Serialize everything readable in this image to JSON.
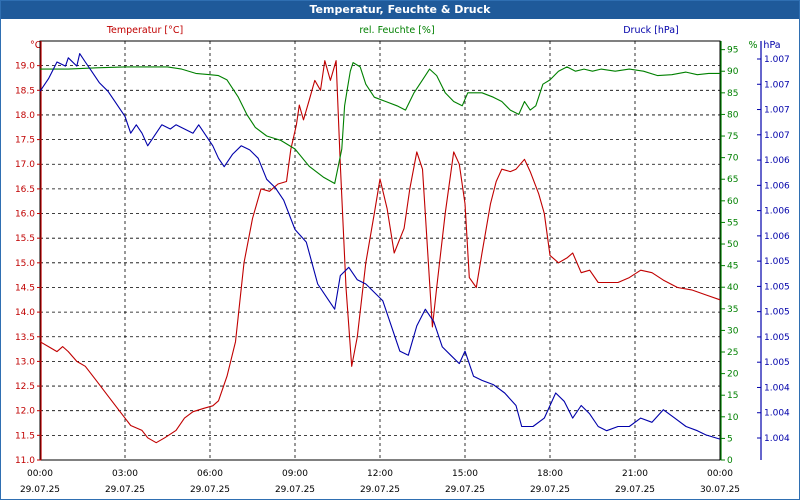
{
  "window": {
    "title": "Temperatur, Feuchte & Druck"
  },
  "colors": {
    "temperature": "#c00000",
    "humidity": "#008000",
    "pressure": "#0000aa",
    "grid": "#000000"
  },
  "chart_data": {
    "type": "line",
    "title": "Temperatur, Feuchte & Druck",
    "x_range": [
      "29.07.25 00:00",
      "30.07.25 00:00"
    ],
    "x_ticks": [
      {
        "time": "00:00",
        "date": "29.07.25"
      },
      {
        "time": "03:00",
        "date": "29.07.25"
      },
      {
        "time": "06:00",
        "date": "29.07.25"
      },
      {
        "time": "09:00",
        "date": "29.07.25"
      },
      {
        "time": "12:00",
        "date": "29.07.25"
      },
      {
        "time": "15:00",
        "date": "29.07.25"
      },
      {
        "time": "18:00",
        "date": "29.07.25"
      },
      {
        "time": "21:00",
        "date": "29.07.25"
      },
      {
        "time": "00:00",
        "date": "30.07.25"
      }
    ],
    "grid": true,
    "axes": {
      "temperature": {
        "label": "Temperatur [°C]",
        "unit": "°C",
        "range": [
          11.0,
          19.5
        ],
        "ticks": [
          "11.0",
          "11.5",
          "12.0",
          "12.5",
          "13.0",
          "13.5",
          "14.0",
          "14.5",
          "15.0",
          "15.5",
          "16.0",
          "16.5",
          "17.0",
          "17.5",
          "18.0",
          "18.5",
          "19.0"
        ]
      },
      "humidity": {
        "label": "rel. Feuchte [%]",
        "unit": "%",
        "range": [
          0,
          97
        ],
        "ticks": [
          "0",
          "5",
          "10",
          "15",
          "20",
          "25",
          "30",
          "35",
          "40",
          "45",
          "50",
          "55",
          "60",
          "65",
          "70",
          "75",
          "80",
          "85",
          "90",
          "95"
        ]
      },
      "pressure": {
        "label": "Druck [hPa]",
        "unit": "hPa",
        "ticks": [
          "1.007",
          "1.007",
          "1.007",
          "1.007",
          "1.006",
          "1.006",
          "1.006",
          "1.006",
          "1.005",
          "1.005",
          "1.005",
          "1.005",
          "1.005",
          "1.004",
          "1.004",
          "1.004"
        ]
      }
    },
    "series": [
      {
        "name": "Temperatur [°C]",
        "axis": "temperature",
        "points": [
          [
            0,
            13.4
          ],
          [
            0.3,
            13.3
          ],
          [
            0.6,
            13.2
          ],
          [
            0.8,
            13.3
          ],
          [
            1.0,
            13.2
          ],
          [
            1.3,
            13.0
          ],
          [
            1.6,
            12.9
          ],
          [
            2.0,
            12.6
          ],
          [
            2.4,
            12.3
          ],
          [
            2.8,
            12.0
          ],
          [
            3.2,
            11.7
          ],
          [
            3.6,
            11.6
          ],
          [
            3.8,
            11.45
          ],
          [
            4.1,
            11.35
          ],
          [
            4.4,
            11.45
          ],
          [
            4.8,
            11.6
          ],
          [
            5.1,
            11.85
          ],
          [
            5.4,
            11.98
          ],
          [
            5.8,
            12.05
          ],
          [
            6.1,
            12.1
          ],
          [
            6.3,
            12.2
          ],
          [
            6.6,
            12.7
          ],
          [
            6.9,
            13.4
          ],
          [
            7.2,
            15.0
          ],
          [
            7.5,
            15.9
          ],
          [
            7.8,
            16.5
          ],
          [
            8.1,
            16.45
          ],
          [
            8.4,
            16.6
          ],
          [
            8.7,
            16.65
          ],
          [
            8.85,
            17.3
          ],
          [
            9.05,
            17.8
          ],
          [
            9.15,
            18.2
          ],
          [
            9.3,
            17.9
          ],
          [
            9.5,
            18.3
          ],
          [
            9.7,
            18.7
          ],
          [
            9.9,
            18.5
          ],
          [
            10.05,
            19.1
          ],
          [
            10.25,
            18.7
          ],
          [
            10.45,
            19.1
          ],
          [
            10.6,
            17.0
          ],
          [
            10.8,
            14.5
          ],
          [
            11.0,
            12.9
          ],
          [
            11.2,
            13.5
          ],
          [
            11.5,
            15.0
          ],
          [
            11.8,
            16.0
          ],
          [
            12.0,
            16.7
          ],
          [
            12.25,
            16.1
          ],
          [
            12.5,
            15.2
          ],
          [
            12.85,
            15.7
          ],
          [
            13.05,
            16.5
          ],
          [
            13.3,
            17.25
          ],
          [
            13.5,
            16.9
          ],
          [
            13.6,
            16.0
          ],
          [
            13.75,
            14.6
          ],
          [
            13.85,
            13.7
          ],
          [
            14.0,
            14.5
          ],
          [
            14.3,
            16.0
          ],
          [
            14.6,
            17.25
          ],
          [
            14.8,
            17.0
          ],
          [
            15.0,
            16.2
          ],
          [
            15.15,
            14.7
          ],
          [
            15.4,
            14.5
          ],
          [
            15.6,
            15.2
          ],
          [
            15.9,
            16.2
          ],
          [
            16.1,
            16.65
          ],
          [
            16.3,
            16.9
          ],
          [
            16.6,
            16.85
          ],
          [
            16.8,
            16.9
          ],
          [
            17.1,
            17.1
          ],
          [
            17.3,
            16.85
          ],
          [
            17.6,
            16.4
          ],
          [
            17.8,
            16.0
          ],
          [
            18.0,
            15.15
          ],
          [
            18.3,
            15.0
          ],
          [
            18.6,
            15.1
          ],
          [
            18.8,
            15.2
          ],
          [
            19.1,
            14.8
          ],
          [
            19.4,
            14.85
          ],
          [
            19.7,
            14.6
          ],
          [
            20.0,
            14.6
          ],
          [
            20.4,
            14.6
          ],
          [
            20.8,
            14.7
          ],
          [
            21.2,
            14.85
          ],
          [
            21.6,
            14.8
          ],
          [
            22.0,
            14.65
          ],
          [
            22.5,
            14.5
          ],
          [
            23.0,
            14.45
          ],
          [
            23.5,
            14.35
          ],
          [
            24.0,
            14.25
          ]
        ]
      },
      {
        "name": "rel. Feuchte [%]",
        "axis": "humidity",
        "points": [
          [
            0,
            90.5
          ],
          [
            1.0,
            90.5
          ],
          [
            2.0,
            90.8
          ],
          [
            3.0,
            91
          ],
          [
            4.0,
            91
          ],
          [
            4.5,
            91
          ],
          [
            5.0,
            90.5
          ],
          [
            5.5,
            89.5
          ],
          [
            6.0,
            89.2
          ],
          [
            6.3,
            89
          ],
          [
            6.6,
            88
          ],
          [
            7.0,
            84
          ],
          [
            7.3,
            80
          ],
          [
            7.6,
            77
          ],
          [
            8.0,
            75
          ],
          [
            8.5,
            74
          ],
          [
            9.0,
            72
          ],
          [
            9.5,
            68
          ],
          [
            10.0,
            65.5
          ],
          [
            10.4,
            64
          ],
          [
            10.65,
            72
          ],
          [
            10.75,
            82
          ],
          [
            10.85,
            86
          ],
          [
            10.95,
            90
          ],
          [
            11.05,
            92
          ],
          [
            11.3,
            91
          ],
          [
            11.5,
            87
          ],
          [
            11.8,
            84
          ],
          [
            12.2,
            83
          ],
          [
            12.6,
            82
          ],
          [
            12.9,
            81
          ],
          [
            13.2,
            85
          ],
          [
            13.5,
            88
          ],
          [
            13.75,
            90.5
          ],
          [
            14.0,
            89
          ],
          [
            14.3,
            85
          ],
          [
            14.6,
            83
          ],
          [
            14.9,
            82
          ],
          [
            15.1,
            85
          ],
          [
            15.3,
            85
          ],
          [
            15.6,
            85
          ],
          [
            16.0,
            84
          ],
          [
            16.3,
            83
          ],
          [
            16.6,
            81
          ],
          [
            16.9,
            80
          ],
          [
            17.1,
            83
          ],
          [
            17.3,
            81
          ],
          [
            17.5,
            82
          ],
          [
            17.75,
            87
          ],
          [
            18.0,
            88
          ],
          [
            18.3,
            90
          ],
          [
            18.6,
            91
          ],
          [
            18.9,
            90
          ],
          [
            19.2,
            90.5
          ],
          [
            19.5,
            90
          ],
          [
            19.8,
            90.5
          ],
          [
            20.3,
            90
          ],
          [
            20.8,
            90.5
          ],
          [
            21.3,
            90
          ],
          [
            21.8,
            89
          ],
          [
            22.3,
            89.2
          ],
          [
            22.8,
            89.8
          ],
          [
            23.2,
            89.2
          ],
          [
            23.6,
            89.5
          ],
          [
            24.0,
            89.5
          ]
        ]
      },
      {
        "name": "Druck [hPa]",
        "axis": "pressure",
        "points": [
          [
            0,
            88
          ],
          [
            0.3,
            91
          ],
          [
            0.6,
            95
          ],
          [
            0.9,
            94
          ],
          [
            1.0,
            96
          ],
          [
            1.3,
            94
          ],
          [
            1.4,
            97
          ],
          [
            1.6,
            95
          ],
          [
            1.8,
            93
          ],
          [
            2.1,
            90
          ],
          [
            2.4,
            88
          ],
          [
            2.6,
            86
          ],
          [
            3.0,
            82
          ],
          [
            3.2,
            78
          ],
          [
            3.4,
            80
          ],
          [
            3.6,
            78
          ],
          [
            3.8,
            75
          ],
          [
            4.0,
            77
          ],
          [
            4.3,
            80
          ],
          [
            4.6,
            79
          ],
          [
            4.8,
            80
          ],
          [
            5.1,
            79
          ],
          [
            5.4,
            78
          ],
          [
            5.6,
            80
          ],
          [
            5.9,
            77
          ],
          [
            6.1,
            75
          ],
          [
            6.3,
            72
          ],
          [
            6.5,
            70
          ],
          [
            6.8,
            73
          ],
          [
            7.1,
            75
          ],
          [
            7.4,
            74
          ],
          [
            7.7,
            72
          ],
          [
            8.0,
            67
          ],
          [
            8.3,
            65
          ],
          [
            8.6,
            62
          ],
          [
            9.0,
            55
          ],
          [
            9.4,
            52
          ],
          [
            9.8,
            42
          ],
          [
            10.2,
            38
          ],
          [
            10.4,
            36
          ],
          [
            10.6,
            44
          ],
          [
            10.9,
            46
          ],
          [
            11.2,
            43
          ],
          [
            11.5,
            42
          ],
          [
            11.8,
            40
          ],
          [
            12.1,
            38
          ],
          [
            12.4,
            32
          ],
          [
            12.7,
            26
          ],
          [
            13.0,
            25
          ],
          [
            13.3,
            32
          ],
          [
            13.6,
            36
          ],
          [
            13.9,
            33
          ],
          [
            14.2,
            27
          ],
          [
            14.5,
            25
          ],
          [
            14.8,
            23
          ],
          [
            15.0,
            26
          ],
          [
            15.3,
            20
          ],
          [
            15.6,
            19
          ],
          [
            16.0,
            18
          ],
          [
            16.4,
            16
          ],
          [
            16.8,
            13
          ],
          [
            17.0,
            8
          ],
          [
            17.4,
            8
          ],
          [
            17.8,
            10
          ],
          [
            18.2,
            16
          ],
          [
            18.5,
            14
          ],
          [
            18.8,
            10
          ],
          [
            19.1,
            13
          ],
          [
            19.4,
            11
          ],
          [
            19.7,
            8
          ],
          [
            20.0,
            7
          ],
          [
            20.4,
            8
          ],
          [
            20.8,
            8
          ],
          [
            21.2,
            10
          ],
          [
            21.6,
            9
          ],
          [
            22.0,
            12
          ],
          [
            22.4,
            10
          ],
          [
            22.8,
            8
          ],
          [
            23.2,
            7
          ],
          [
            23.5,
            6
          ],
          [
            24.0,
            5
          ]
        ]
      }
    ]
  }
}
